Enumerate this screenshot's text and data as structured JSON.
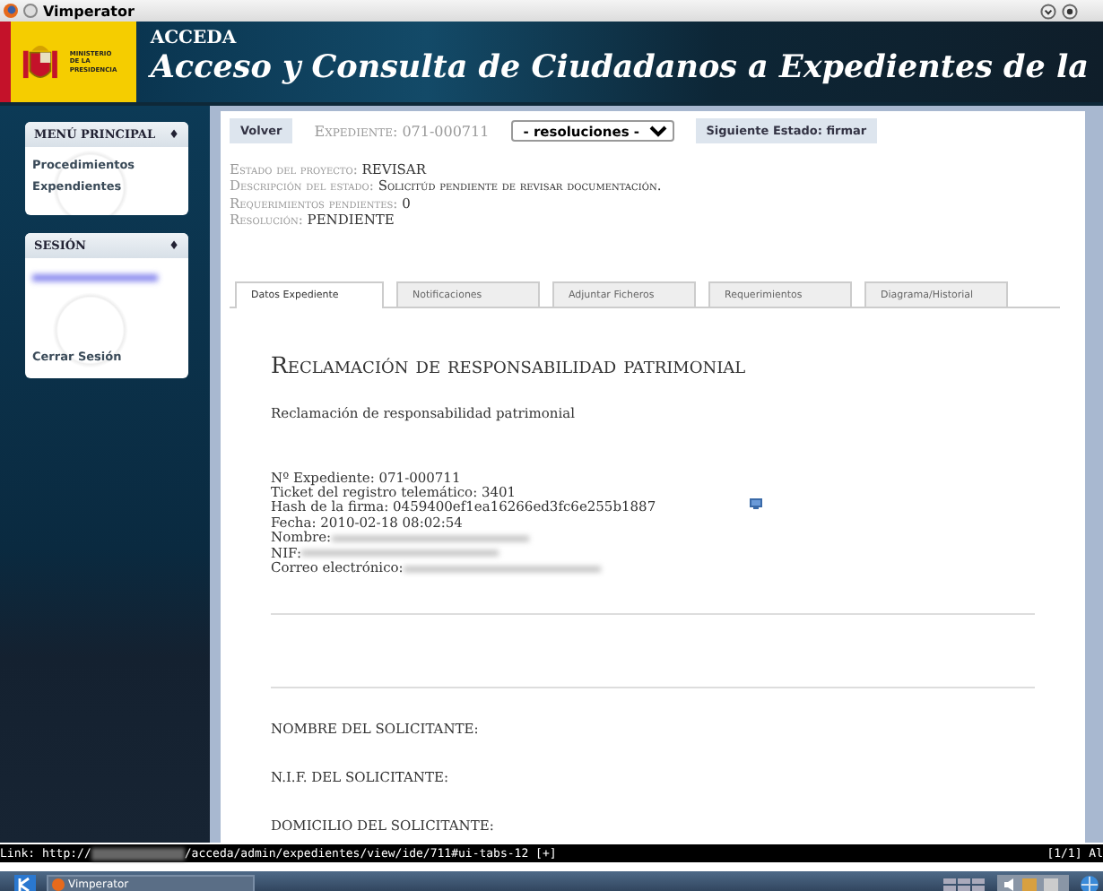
{
  "window": {
    "title": "Vimperator"
  },
  "header": {
    "ministry_line_1": "MINISTERIO",
    "ministry_line_2": "DE LA PRESIDENCIA",
    "app_short": "ACCEDA",
    "app_title": "Acceso y Consulta de Ciudadanos a Expedientes de la"
  },
  "sidebar": {
    "sections": [
      {
        "title": "MENÚ PRINCIPAL",
        "toggle": "♦",
        "items": [
          "Procedimientos",
          "Expendientes"
        ]
      },
      {
        "title": "SESIÓN",
        "toggle": "♦",
        "items": [
          "Cerrar Sesión"
        ]
      }
    ]
  },
  "toolbar": {
    "back_button": "Volver",
    "expediente_label": "Expediente:",
    "expediente_value": "071-000711",
    "resolutions_select": "- resoluciones -",
    "next_state_button": "Siguiente Estado: firmar"
  },
  "status_fields": [
    {
      "label": "Estado del proyecto:",
      "value": "REVISAR"
    },
    {
      "label": "Descripción del estado:",
      "value": "Solicitúd pendiente de revisar documentación."
    },
    {
      "label": "Requerimientos pendientes:",
      "value": "0"
    },
    {
      "label": "Resolución:",
      "value": "PENDIENTE"
    }
  ],
  "tabs": [
    {
      "label": "Datos Expediente",
      "selected": true
    },
    {
      "label": "Notificaciones",
      "selected": false
    },
    {
      "label": "Adjuntar Ficheros",
      "selected": false
    },
    {
      "label": "Requerimientos",
      "selected": false
    },
    {
      "label": "Diagrama/Historial",
      "selected": false
    }
  ],
  "document": {
    "title": "Reclamación de responsabilidad patrimonial",
    "subtitle": "Reclamación de responsabilidad patrimonial",
    "details": [
      {
        "text": "Nº Expediente: 071-000711",
        "redacted": false
      },
      {
        "text": "Ticket del registro telemático: 3401",
        "redacted": false
      },
      {
        "text": "Hash de la firma: 0459400ef1ea16266ed3fc6e255b1887",
        "redacted": false
      },
      {
        "text": "Fecha: 2010-02-18 08:02:54",
        "redacted": false
      },
      {
        "text": "Nombre:",
        "redacted": true
      },
      {
        "text": "NIF:",
        "redacted": true
      },
      {
        "text": "Correo electrónico:",
        "redacted": true
      }
    ],
    "fields": [
      "NOMBRE DEL SOLICITANTE:",
      "N.I.F. DEL SOLICITANTE:",
      "DOMICILIO DEL SOLICITANTE:"
    ]
  },
  "status_bar": {
    "link_prefix": "Link: http://",
    "link_path": "/acceda/admin/expedientes/view/ide/711#ui-tabs-12 [+]",
    "position": "[1/1] Al"
  },
  "taskbar": {
    "task": "Vimperator"
  }
}
